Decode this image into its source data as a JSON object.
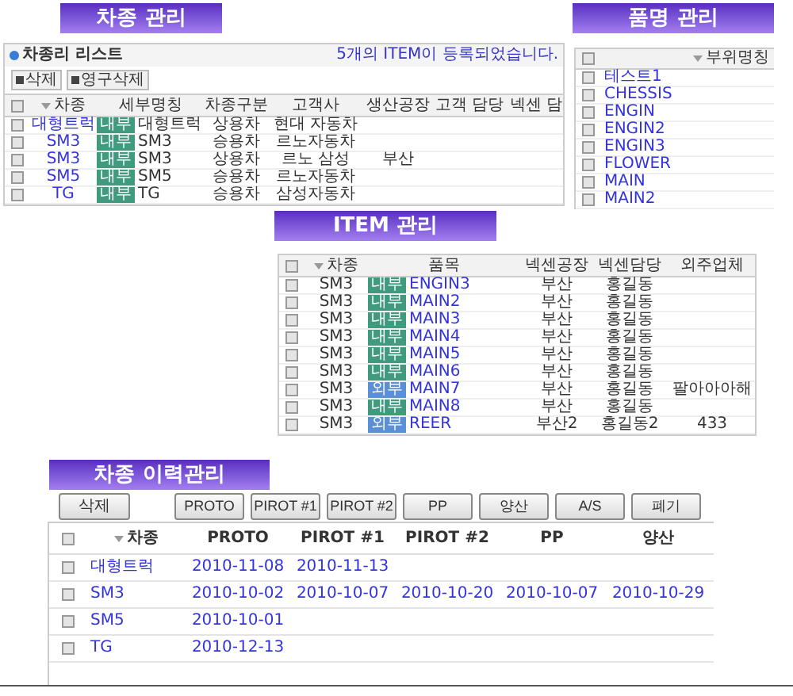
{
  "car_panel": {
    "banner": "차종 관리",
    "list_title": "차종리 리스트",
    "notice": "5개의 ITEM이 등록되었습니다.",
    "buttons": [
      "삭제",
      "영구삭제"
    ],
    "header_checked": false,
    "columns": [
      "차종",
      "세부명칭",
      "차종구분",
      "고객사",
      "생산공장",
      "고객 담당",
      "넥센 담"
    ],
    "rows": [
      {
        "checked": false,
        "car": "대형트럭",
        "badge": "내부",
        "detail": "대형트럭",
        "type": "상용차",
        "customer": "현대 자동차"
      },
      {
        "checked": false,
        "car": "SM3",
        "badge": "내부",
        "detail": "SM3",
        "type": "승용차",
        "customer": "르노자동차"
      },
      {
        "checked": false,
        "car": "SM3",
        "badge": "내부",
        "detail": "SM3",
        "type": "상용차",
        "customer": "르노 삼성",
        "plant": "부산"
      },
      {
        "checked": false,
        "car": "SM5",
        "badge": "내부",
        "detail": "SM5",
        "type": "승용차",
        "customer": "르노자동차"
      },
      {
        "checked": false,
        "car": "TG",
        "badge": "내부",
        "detail": "TG",
        "type": "승용차",
        "customer": "삼성자동차"
      }
    ]
  },
  "part_panel": {
    "banner": "품명 관리",
    "header_checked": false,
    "column": "부위명칭",
    "rows": [
      {
        "checked": false,
        "name": "테스트1"
      },
      {
        "checked": false,
        "name": "CHESSIS"
      },
      {
        "checked": false,
        "name": "ENGIN"
      },
      {
        "checked": false,
        "name": "ENGIN2"
      },
      {
        "checked": false,
        "name": "ENGIN3"
      },
      {
        "checked": false,
        "name": "FLOWER"
      },
      {
        "checked": false,
        "name": "MAIN"
      },
      {
        "checked": false,
        "name": "MAIN2"
      }
    ]
  },
  "item_panel": {
    "banner": "ITEM 관리",
    "header_checked": false,
    "columns": [
      "차종",
      "품목",
      "넥센공장",
      "넥센담당",
      "외주업체"
    ],
    "rows": [
      {
        "checked": false,
        "car": "SM3",
        "kind": "internal",
        "badge": "내부",
        "item": "ENGIN3",
        "plant": "부산",
        "manager": "홍길동"
      },
      {
        "checked": false,
        "car": "SM3",
        "kind": "internal",
        "badge": "내부",
        "item": "MAIN2",
        "plant": "부산",
        "manager": "홍길동"
      },
      {
        "checked": false,
        "car": "SM3",
        "kind": "internal",
        "badge": "내부",
        "item": "MAIN3",
        "plant": "부산",
        "manager": "홍길동"
      },
      {
        "checked": false,
        "car": "SM3",
        "kind": "internal",
        "badge": "내부",
        "item": "MAIN4",
        "plant": "부산",
        "manager": "홍길동"
      },
      {
        "checked": false,
        "car": "SM3",
        "kind": "internal",
        "badge": "내부",
        "item": "MAIN5",
        "plant": "부산",
        "manager": "홍길동"
      },
      {
        "checked": false,
        "car": "SM3",
        "kind": "internal",
        "badge": "내부",
        "item": "MAIN6",
        "plant": "부산",
        "manager": "홍길동"
      },
      {
        "checked": false,
        "car": "SM3",
        "kind": "external",
        "badge": "외부",
        "item": "MAIN7",
        "plant": "부산",
        "manager": "홍길동",
        "vendor": "팔아아아해"
      },
      {
        "checked": false,
        "car": "SM3",
        "kind": "internal",
        "badge": "내부",
        "item": "MAIN8",
        "plant": "부산",
        "manager": "홍길동"
      },
      {
        "checked": false,
        "car": "SM3",
        "kind": "external",
        "badge": "외부",
        "item": "REER",
        "plant": "부산2",
        "manager": "홍길동2",
        "vendor": "433"
      }
    ]
  },
  "history_panel": {
    "banner": "차종 이력관리",
    "delete_button": "삭제",
    "stage_buttons": [
      "PROTO",
      "PIROT #1",
      "PIROT #2",
      "PP",
      "양산",
      "A/S",
      "폐기"
    ],
    "header_checked": false,
    "columns": [
      "차종",
      "PROTO",
      "PIROT #1",
      "PIROT #2",
      "PP",
      "양산"
    ],
    "rows": [
      {
        "checked": false,
        "car": "대형트럭",
        "proto": "2010-11-08",
        "pirot_1": "2010-11-13"
      },
      {
        "checked": false,
        "car": "SM3",
        "proto": "2010-10-02",
        "pirot_1": "2010-10-07",
        "pirot_2": "2010-10-20",
        "pp": "2010-10-07",
        "mass_production": "2010-10-29"
      },
      {
        "checked": false,
        "car": "SM5",
        "proto": "2010-10-01"
      },
      {
        "checked": false,
        "car": "TG",
        "proto": "2010-12-13"
      }
    ]
  }
}
